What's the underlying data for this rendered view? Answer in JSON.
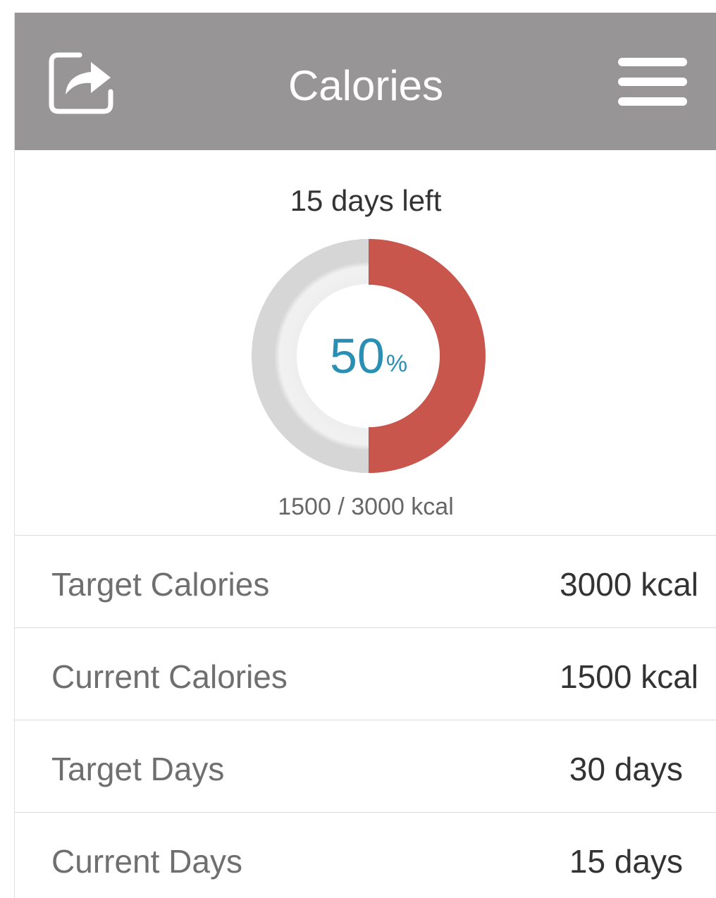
{
  "header": {
    "title": "Calories",
    "share_icon": "share-icon",
    "menu_icon": "hamburger-menu-icon",
    "background_color": "#979596"
  },
  "summary": {
    "days_left": "15 days left",
    "progress": {
      "percent_value": "50",
      "percent_symbol": "%",
      "fraction": 0.5,
      "filled_color": "#c8564c",
      "track_color": "#efefef",
      "text_color": "#2b8fb3"
    },
    "kcal_total": "1500 / 3000 kcal"
  },
  "stats": [
    {
      "label": "Target Calories",
      "value": "3000 kcal"
    },
    {
      "label": "Current Calories",
      "value": "1500 kcal"
    },
    {
      "label": "Target Days",
      "value": "30 days"
    },
    {
      "label": "Current Days",
      "value": "15 days"
    }
  ]
}
